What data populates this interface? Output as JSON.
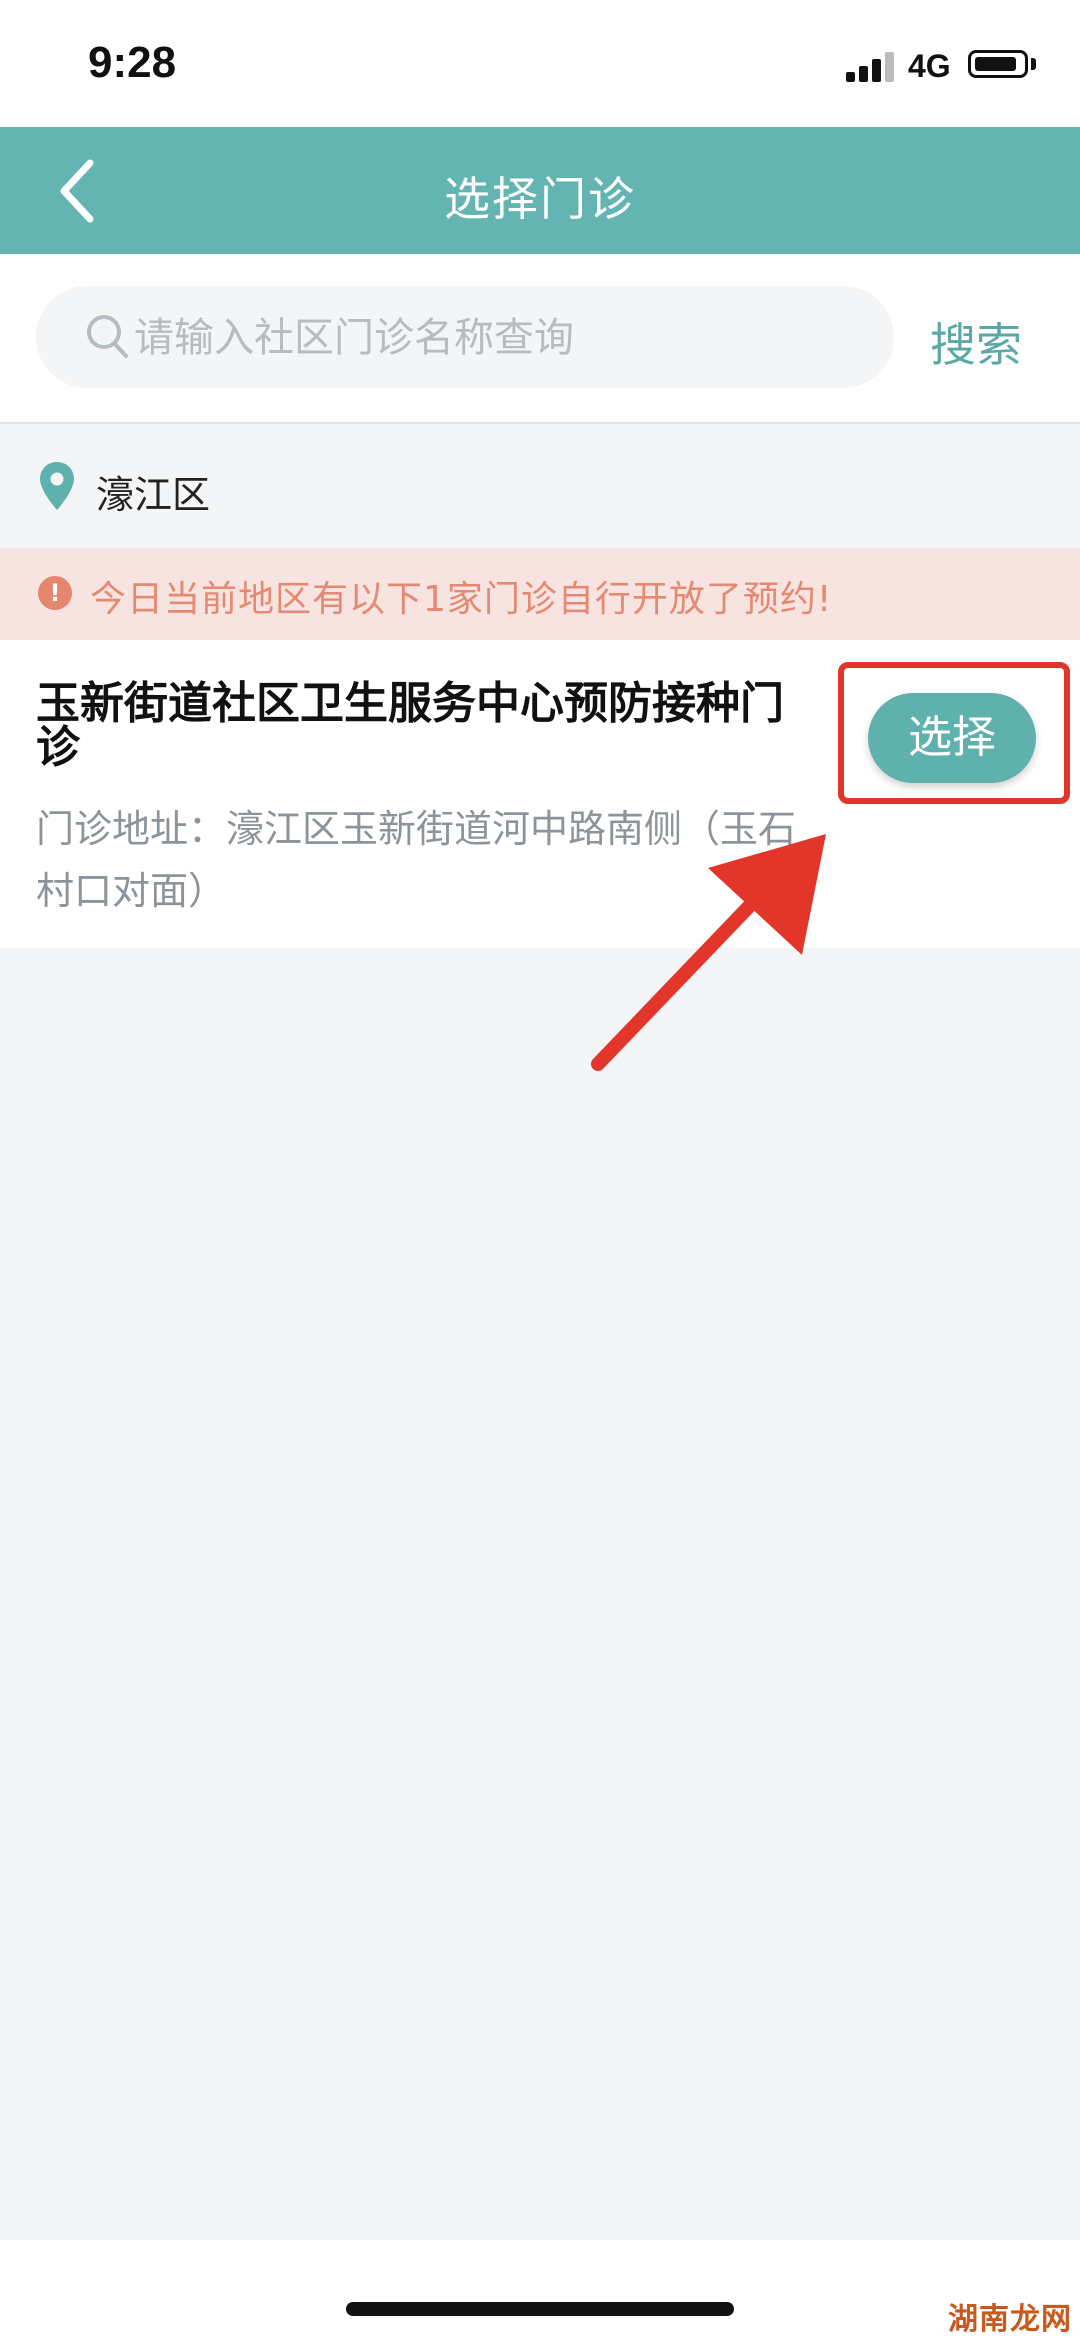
{
  "status_bar": {
    "time": "9:28",
    "network": "4G"
  },
  "nav": {
    "title": "选择门诊"
  },
  "search": {
    "placeholder": "请输入社区门诊名称查询",
    "value": "",
    "button_label": "搜索"
  },
  "district": {
    "name": "濠江区"
  },
  "notice": {
    "text": "今日当前地区有以下1家门诊自行开放了预约!"
  },
  "clinics": [
    {
      "name": "玉新街道社区卫生服务中心预防接种门诊",
      "address": "门诊地址：濠江区玉新街道河中路南侧（玉石村口对面）",
      "select_label": "选择"
    }
  ],
  "watermark": "湖南龙网",
  "colors": {
    "nav_bar": "#64b4b2",
    "accent": "#5fb1ad",
    "notice_bg": "#f7e4e1",
    "notice_text": "#e58a72",
    "highlight": "#e2362b"
  },
  "icons": {
    "back": "chevron-left-icon",
    "search": "magnifier-icon",
    "location": "map-pin-icon",
    "notice": "exclamation-icon"
  }
}
